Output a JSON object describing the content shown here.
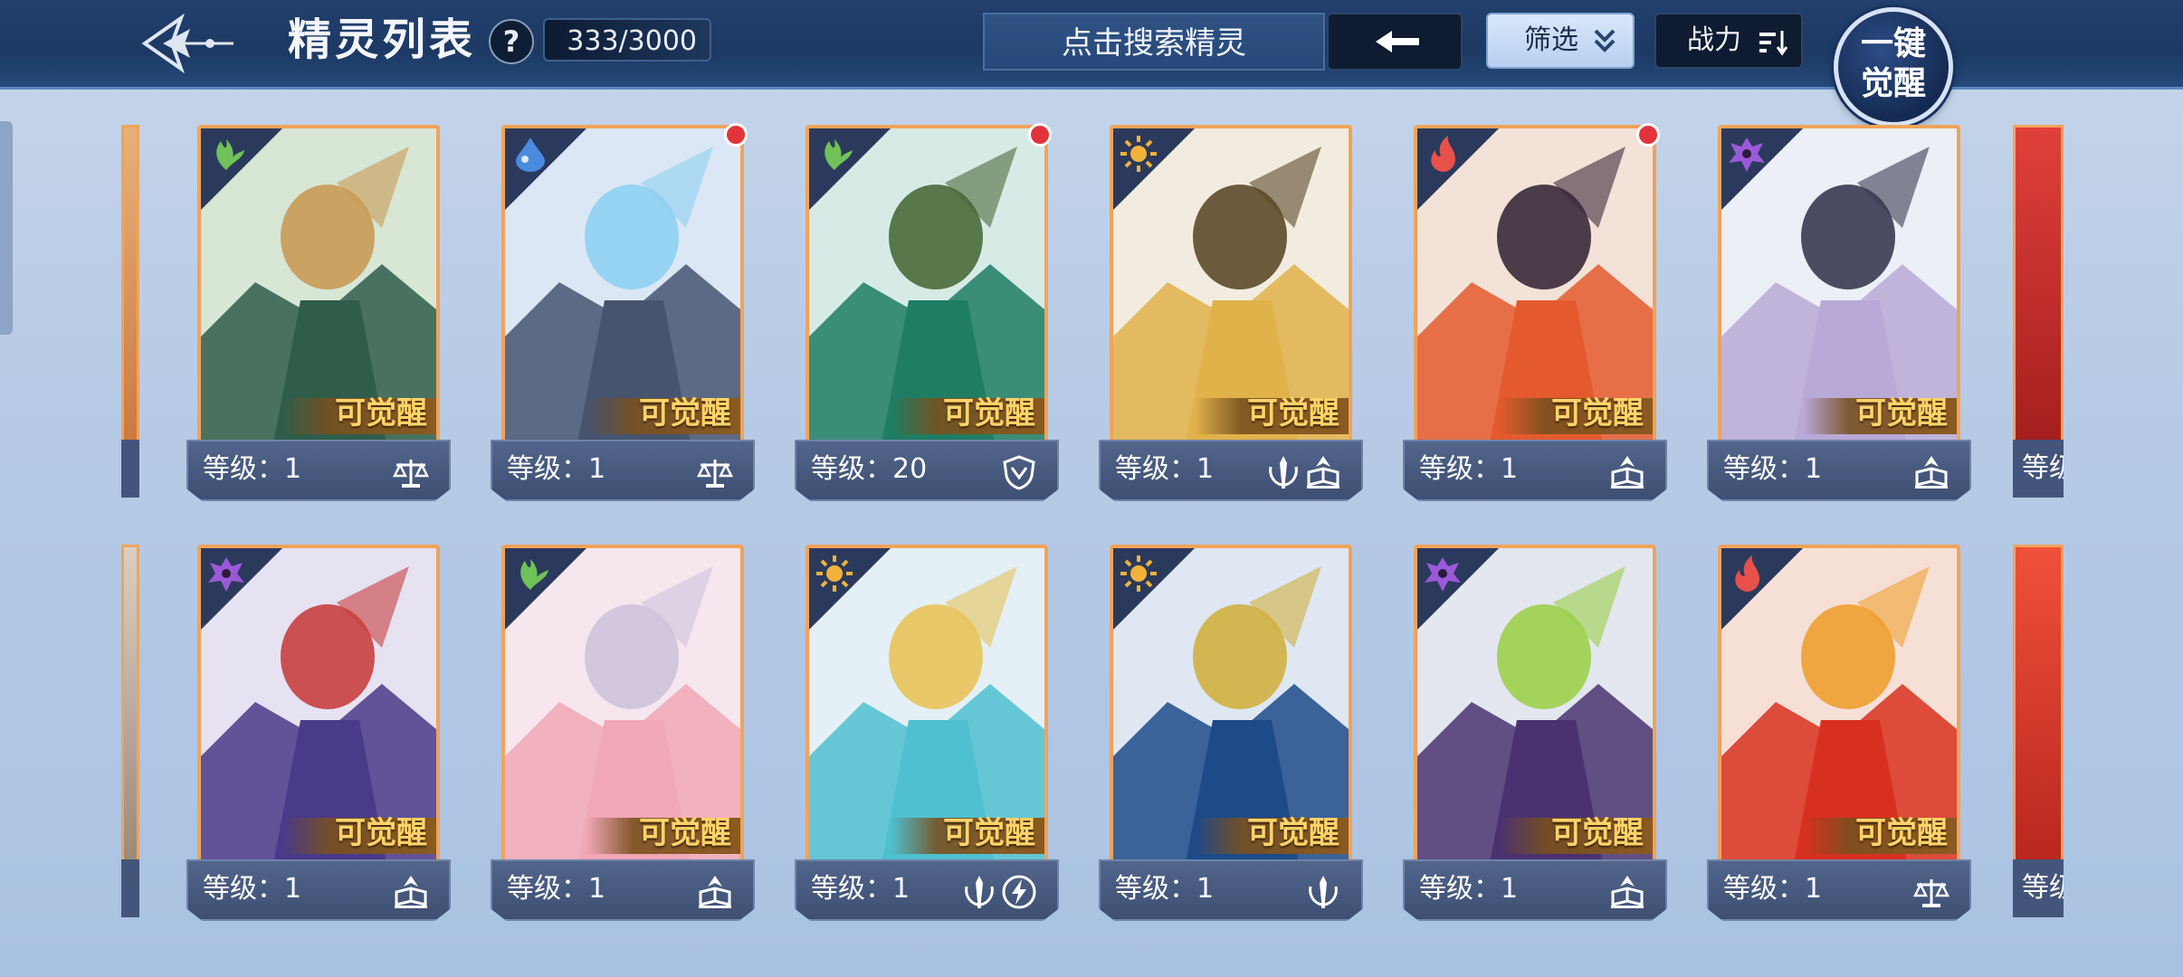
{
  "header": {
    "title": "精灵列表",
    "help": "?",
    "count": "333/3000",
    "search_placeholder": "点击搜索精灵",
    "filter_label": "筛选",
    "sort_label": "战力",
    "awaken_line1": "一键",
    "awaken_line2": "觉醒"
  },
  "badge": "可觉醒",
  "colors": {
    "wood": "#6fc257",
    "water": "#4a8be0",
    "light": "#f2b33a",
    "fire": "#e8504a",
    "dark": "#9a5ad8"
  },
  "cards": [
    {
      "element": "wood",
      "level": "等级：1",
      "classes": [
        "scale"
      ],
      "dot": false,
      "art": "bear-shield"
    },
    {
      "element": "water",
      "level": "等级：1",
      "classes": [
        "scale"
      ],
      "dot": true,
      "art": "wolf-knight"
    },
    {
      "element": "wood",
      "level": "等级：20",
      "classes": [
        "shield"
      ],
      "dot": true,
      "art": "elf-ranger"
    },
    {
      "element": "light",
      "level": "等级：1",
      "classes": [
        "sword",
        "book"
      ],
      "dot": false,
      "art": "golden-hero"
    },
    {
      "element": "fire",
      "level": "等级：1",
      "classes": [
        "book"
      ],
      "dot": true,
      "art": "fire-girl"
    },
    {
      "element": "dark",
      "level": "等级：1",
      "classes": [
        "book"
      ],
      "dot": false,
      "art": "silver-mage"
    },
    {
      "element": "dark",
      "level": "等级：1",
      "classes": [
        "book"
      ],
      "dot": false,
      "art": "witch-goat"
    },
    {
      "element": "wood",
      "level": "等级：1",
      "classes": [
        "book"
      ],
      "dot": false,
      "art": "pink-fairy"
    },
    {
      "element": "light",
      "level": "等级：1",
      "classes": [
        "sword",
        "bolt"
      ],
      "dot": false,
      "art": "crystal-dragon"
    },
    {
      "element": "light",
      "level": "等级：1",
      "classes": [
        "sword"
      ],
      "dot": false,
      "art": "blue-dragon"
    },
    {
      "element": "dark",
      "level": "等级：1",
      "classes": [
        "book"
      ],
      "dot": false,
      "art": "shadow-beast"
    },
    {
      "element": "fire",
      "level": "等级：1",
      "classes": [
        "scale"
      ],
      "dot": false,
      "art": "red-dragon"
    }
  ],
  "partial_right_label": "等级"
}
